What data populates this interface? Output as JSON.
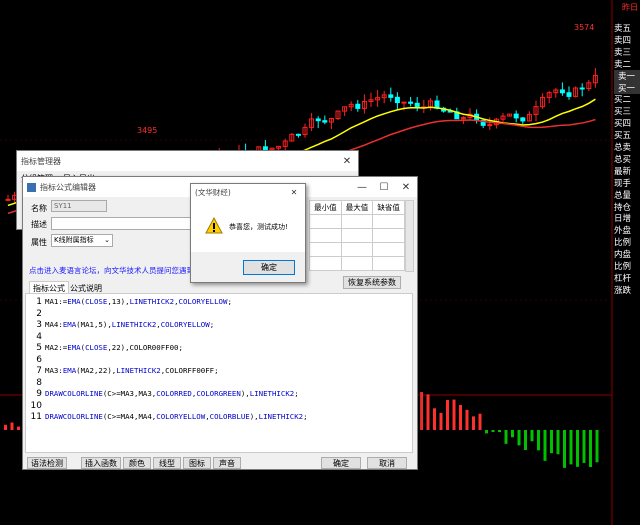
{
  "chart": {
    "high_label": "3574",
    "mid_label": "3495",
    "top_right_label": "昨日",
    "colors": {
      "up": "#ff2020",
      "down": "#00ffff",
      "yellow": "#ffff00",
      "red_line": "#e83030",
      "blue_line": "#1e5fff",
      "green_hist": "#00c000",
      "red_hist": "#ff3030"
    }
  },
  "sidebar": {
    "items": [
      "卖五",
      "卖四",
      "卖三",
      "卖二",
      "卖一",
      "买一",
      "买二",
      "买三",
      "买四",
      "买五",
      "总卖",
      "总买",
      "最新",
      "现手",
      "总量",
      "持仓",
      "日增",
      "外盘",
      "比例",
      "内盘",
      "比例",
      "杠杆",
      "涨跌"
    ]
  },
  "indicator_manager": {
    "title": "指标管理器",
    "menu": [
      "分组管理",
      "导入导出"
    ]
  },
  "formula_editor": {
    "title": "指标公式编辑器",
    "name_label": "名称",
    "name_value": "SY11",
    "desc_label": "描述",
    "desc_value": "",
    "attr_label": "属性",
    "attr_value": "K线附属指标",
    "link_text": "点击进入麦语言论坛，向文华技术人员提问您遇到的",
    "table_headers": [
      "最小值",
      "最大值",
      "缺省值"
    ],
    "restore_button": "恢复系统参数",
    "tabs": [
      "指标公式",
      "公式说明"
    ],
    "code_lines": [
      {
        "num": "1",
        "text": "MA1:=EMA(CLOSE,13),LINETHICK2,COLORYELLOW;"
      },
      {
        "num": "2",
        "text": ""
      },
      {
        "num": "3",
        "text": "MA4:EMA(MA1,5),LINETHICK2,COLORYELLOW;"
      },
      {
        "num": "4",
        "text": ""
      },
      {
        "num": "5",
        "text": "MA2:=EMA(CLOSE,22),COLOR00FF00;"
      },
      {
        "num": "6",
        "text": ""
      },
      {
        "num": "7",
        "text": "MA3:EMA(MA2,22),LINETHICK2,COLORFF00FF;"
      },
      {
        "num": "8",
        "text": ""
      },
      {
        "num": "9",
        "text": "DRAWCOLORLINE(C>=MA3,MA3,COLORRED,COLORGREEN),LINETHICK2;"
      },
      {
        "num": "10",
        "text": ""
      },
      {
        "num": "11",
        "text": "DRAWCOLORLINE(C>=MA4,MA4,COLORYELLOW,COLORBLUE),LINETHICK2;"
      }
    ],
    "bottom_buttons": [
      "语法检测",
      "插入函数",
      "颜色",
      "线型",
      "图标",
      "声音"
    ],
    "ok_button": "确定",
    "cancel_button": "取消"
  },
  "message_box": {
    "title": "(文华财经)",
    "message": "恭喜您，测试成功!",
    "ok_button": "确定"
  }
}
